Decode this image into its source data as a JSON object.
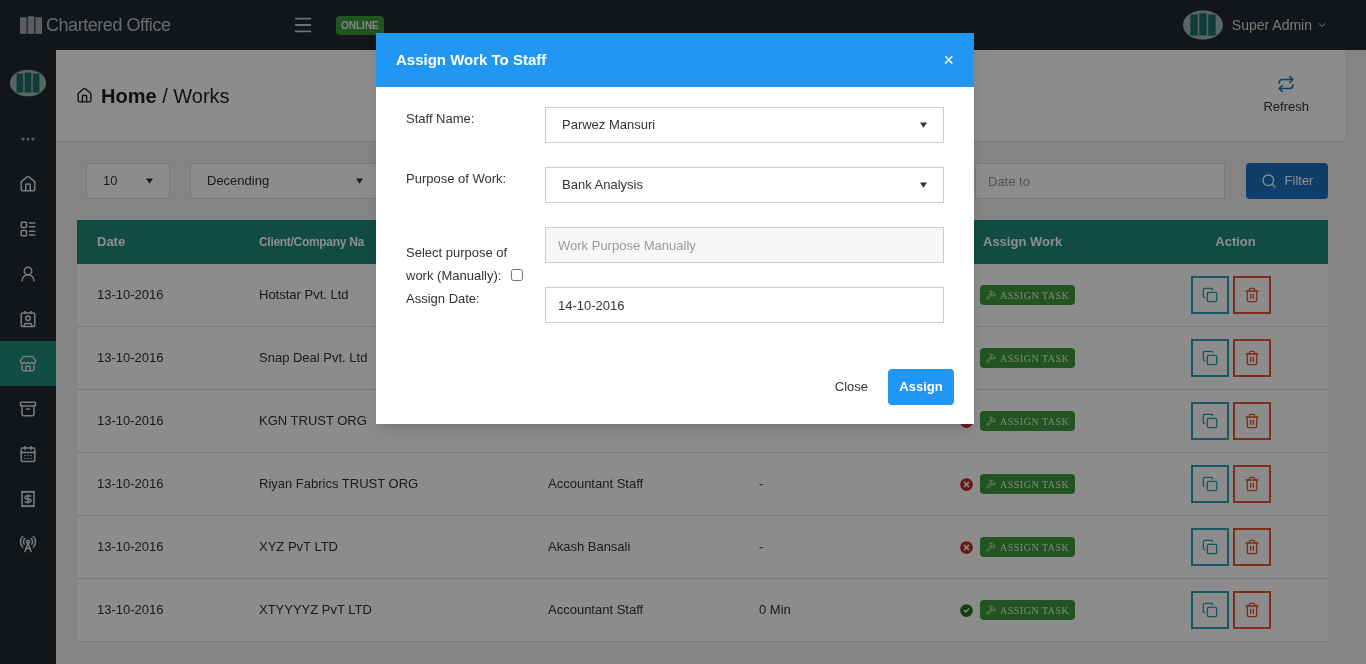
{
  "topbar": {
    "brand": "Chartered Office",
    "status_badge": "ONLINE",
    "user": "Super Admin"
  },
  "sidebar": {
    "items": [
      {
        "selected": false
      },
      {
        "selected": false
      },
      {
        "selected": false
      },
      {
        "selected": false
      },
      {
        "selected": false
      },
      {
        "selected": true
      },
      {
        "selected": false
      },
      {
        "selected": false
      },
      {
        "selected": false
      },
      {
        "selected": false
      }
    ]
  },
  "breadcrumb": {
    "home": "Home",
    "separator": "/",
    "current": "Works"
  },
  "refresh_button": "Refresh",
  "filters": {
    "page_size": "10",
    "order": "Decending",
    "date_to_placeholder": "Date to",
    "filter_button": "Filter"
  },
  "table": {
    "columns": {
      "date": "Date",
      "client": "Client/Company Na",
      "assign": "Assign Work",
      "action": "Action"
    },
    "rows": [
      {
        "date": "13-10-2016",
        "client": "Hotstar Pvt. Ltd",
        "assign_button": "ASSIGN TASK"
      },
      {
        "date": "13-10-2016",
        "client": "Snap Deal Pvt. Ltd",
        "assign_button": "ASSIGN TASK"
      },
      {
        "date": "13-10-2016",
        "client": "KGN TRUST ORG",
        "done": false,
        "assign_button": "ASSIGN TASK"
      },
      {
        "date": "13-10-2016",
        "client": "Riyan Fabrics TRUST ORG",
        "staff": "Accountant Staff",
        "time": "-",
        "done": false,
        "assign_button": "ASSIGN TASK"
      },
      {
        "date": "13-10-2016",
        "client": "XYZ PvT LTD",
        "staff": "Akash Bansali",
        "time": "-",
        "done": false,
        "assign_button": "ASSIGN TASK"
      },
      {
        "date": "13-10-2016",
        "client": "XTYYYYZ PvT LTD",
        "staff": "Accountant Staff",
        "time": "0 Min",
        "done": true,
        "assign_button": "ASSIGN TASK"
      }
    ]
  },
  "modal": {
    "title": "Assign Work To Staff",
    "close_icon": "×",
    "staff_label": "Staff Name:",
    "staff_value": "Parwez Mansuri",
    "purpose_label": "Purpose of Work:",
    "purpose_value": "Bank Analysis",
    "manual_label": "Select purpose of work (Manually):",
    "manual_checked": false,
    "manual_placeholder": "Work Purpose Manually",
    "date_label": "Assign Date:",
    "date_value": "14-10-2016",
    "close_button": "Close",
    "assign_button": "Assign"
  }
}
